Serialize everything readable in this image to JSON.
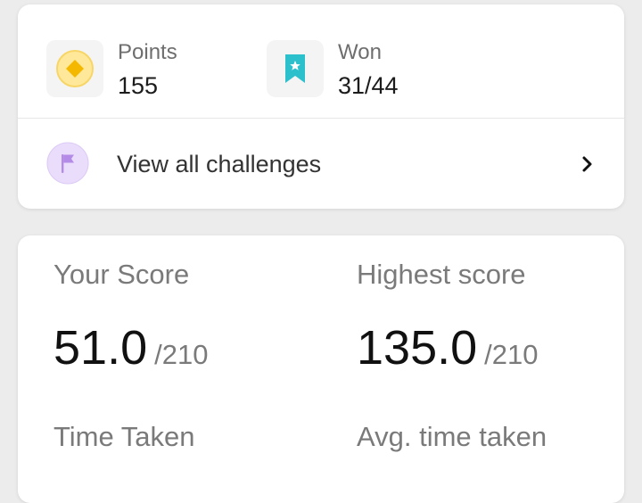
{
  "summary": {
    "points_label": "Points",
    "points_value": "155",
    "won_label": "Won",
    "won_value": "31/44",
    "challenges_link": "View all challenges"
  },
  "scores": {
    "your_score_label": "Your Score",
    "your_score_value": "51.0",
    "your_score_total": "/210",
    "highest_score_label": "Highest score",
    "highest_score_value": "135.0",
    "highest_score_total": "/210",
    "time_taken_label": "Time Taken",
    "avg_time_label": "Avg. time taken"
  },
  "icons": {
    "points": "coin-icon",
    "won": "bookmark-badge-icon",
    "challenges": "flag-icon",
    "chevron": "chevron-right-icon"
  },
  "colors": {
    "background": "#ececec",
    "coin_fill": "#ffe89a",
    "coin_diamond": "#f5b800",
    "badge": "#2cc0cc",
    "flag_circle": "#eadcfb",
    "flag": "#b48be6"
  }
}
